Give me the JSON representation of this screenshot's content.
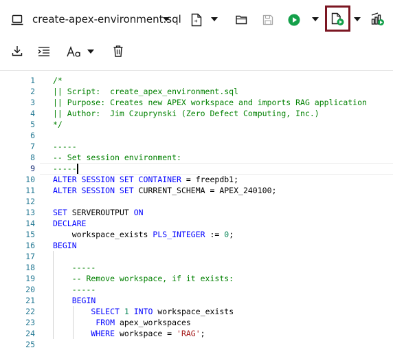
{
  "toolbar": {
    "file_name": "create-apex-environment.sql",
    "icons": [
      "laptop-icon",
      "chevron-down-icon",
      "new-file-icon",
      "folder-open-icon",
      "save-icon",
      "run-icon",
      "run-script-icon",
      "explain-plan-icon",
      "download-icon",
      "format-code-icon",
      "font-case-icon",
      "trash-icon"
    ],
    "highlight_color": "#7b1622"
  },
  "editor": {
    "current_line": 9,
    "lines": [
      {
        "n": "1",
        "segs": [
          {
            "t": "/*",
            "c": "cm"
          }
        ]
      },
      {
        "n": "2",
        "segs": [
          {
            "t": "|| Script:  create_apex_environment.sql",
            "c": "cm"
          }
        ]
      },
      {
        "n": "3",
        "segs": [
          {
            "t": "|| Purpose: Creates new APEX workspace and imports RAG application",
            "c": "cm"
          }
        ]
      },
      {
        "n": "4",
        "segs": [
          {
            "t": "|| Author:  Jim Czuprynski (Zero Defect Computing, Inc.)",
            "c": "cm"
          }
        ]
      },
      {
        "n": "5",
        "segs": [
          {
            "t": "*/",
            "c": "cm"
          }
        ]
      },
      {
        "n": "6",
        "segs": []
      },
      {
        "n": "7",
        "segs": [
          {
            "t": "-----",
            "c": "cm"
          }
        ]
      },
      {
        "n": "8",
        "segs": [
          {
            "t": "-- Set session environment:",
            "c": "cm"
          }
        ]
      },
      {
        "n": "9",
        "segs": [
          {
            "t": "-----",
            "c": "cm"
          }
        ]
      },
      {
        "n": "10",
        "segs": [
          {
            "t": "ALTER SESSION SET CONTAINER",
            "c": "kw"
          },
          {
            "t": " = freepdb1;",
            "c": ""
          }
        ]
      },
      {
        "n": "11",
        "segs": [
          {
            "t": "ALTER SESSION SET",
            "c": "kw"
          },
          {
            "t": " CURRENT_SCHEMA = APEX_240100;",
            "c": ""
          }
        ]
      },
      {
        "n": "12",
        "segs": []
      },
      {
        "n": "13",
        "segs": [
          {
            "t": "SET",
            "c": "kw"
          },
          {
            "t": " SERVEROUTPUT ",
            "c": ""
          },
          {
            "t": "ON",
            "c": "kw"
          }
        ]
      },
      {
        "n": "14",
        "segs": [
          {
            "t": "DECLARE",
            "c": "kw"
          }
        ]
      },
      {
        "n": "15",
        "segs": [
          {
            "t": "    workspace_exists ",
            "c": ""
          },
          {
            "t": "PLS_INTEGER",
            "c": "kw"
          },
          {
            "t": " := ",
            "c": ""
          },
          {
            "t": "0",
            "c": "nm"
          },
          {
            "t": ";",
            "c": ""
          }
        ]
      },
      {
        "n": "16",
        "segs": [
          {
            "t": "BEGIN",
            "c": "kw"
          }
        ]
      },
      {
        "n": "17",
        "segs": []
      },
      {
        "n": "18",
        "segs": [
          {
            "t": "    -----",
            "c": "cm"
          }
        ]
      },
      {
        "n": "19",
        "segs": [
          {
            "t": "    -- Remove workspace, if it exists:",
            "c": "cm"
          }
        ]
      },
      {
        "n": "20",
        "segs": [
          {
            "t": "    -----",
            "c": "cm"
          }
        ]
      },
      {
        "n": "21",
        "segs": [
          {
            "t": "    BEGIN",
            "c": "kw"
          }
        ]
      },
      {
        "n": "22",
        "segs": [
          {
            "t": "        ",
            "c": ""
          },
          {
            "t": "SELECT",
            "c": "kw"
          },
          {
            "t": " ",
            "c": ""
          },
          {
            "t": "1",
            "c": "nm"
          },
          {
            "t": " ",
            "c": ""
          },
          {
            "t": "INTO",
            "c": "kw"
          },
          {
            "t": " workspace_exists",
            "c": ""
          }
        ]
      },
      {
        "n": "23",
        "segs": [
          {
            "t": "         ",
            "c": ""
          },
          {
            "t": "FROM",
            "c": "kw"
          },
          {
            "t": " apex_workspaces",
            "c": ""
          }
        ]
      },
      {
        "n": "24",
        "segs": [
          {
            "t": "        ",
            "c": ""
          },
          {
            "t": "WHERE",
            "c": "kw"
          },
          {
            "t": " workspace = ",
            "c": ""
          },
          {
            "t": "'RAG'",
            "c": "st"
          },
          {
            "t": ";",
            "c": ""
          }
        ]
      },
      {
        "n": "25",
        "segs": []
      }
    ]
  }
}
